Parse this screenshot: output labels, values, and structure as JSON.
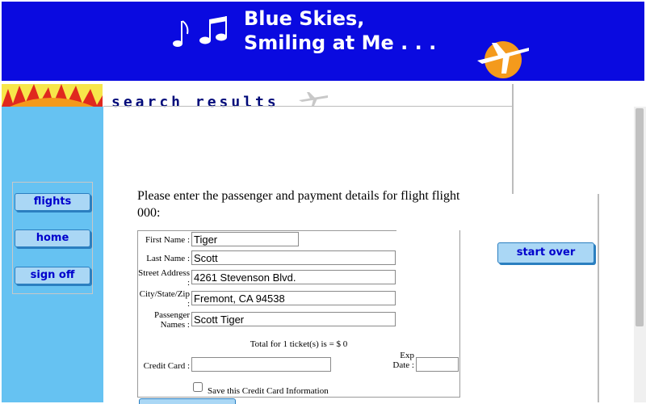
{
  "banner": {
    "title": "Blue Skies,\nSmiling at Me . . ."
  },
  "sidebar": {
    "items": [
      {
        "label": "flights"
      },
      {
        "label": "home"
      },
      {
        "label": "sign off"
      }
    ]
  },
  "results": {
    "heading": "search results"
  },
  "form": {
    "intro": "Please enter the passenger and payment details for flight flight 000:",
    "fields": {
      "first_name": {
        "label": "First Name :",
        "value": "Tiger"
      },
      "last_name": {
        "label": "Last Name :",
        "value": "Scott"
      },
      "street": {
        "label": "Street Address :",
        "value": "4261 Stevenson Blvd."
      },
      "city": {
        "label": "City/State/Zip :",
        "value": "Fremont, CA 94538"
      },
      "passengers": {
        "label": "Passenger Names :",
        "value": "Scott Tiger"
      },
      "credit_card": {
        "label": "Credit Card :",
        "value": ""
      },
      "exp_date": {
        "label": "Exp Date :",
        "value": ""
      }
    },
    "total_text": "Total for 1 ticket(s) is = $ 0",
    "save_card_label": "Save this Credit Card Information"
  },
  "start_over": {
    "label": "start over"
  },
  "colors": {
    "banner": "#0a0ae0",
    "sidebar": "#66c2f2",
    "button": "#aad7f5",
    "heading": "#000a7a"
  }
}
